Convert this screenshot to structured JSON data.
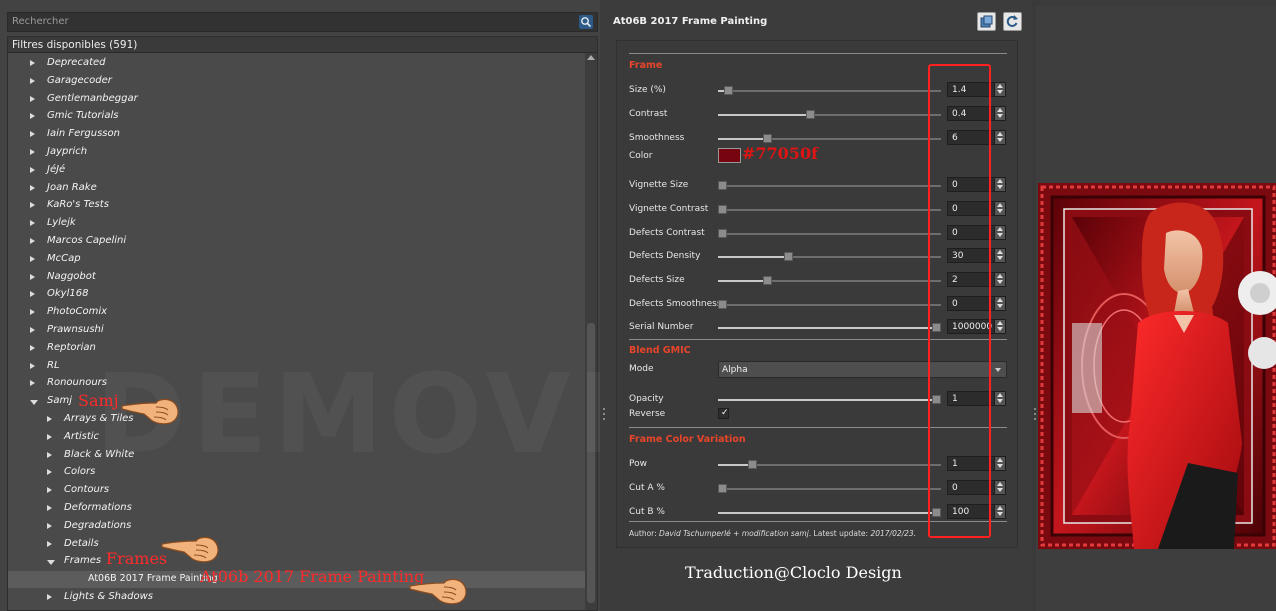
{
  "search": {
    "placeholder": "Rechercher"
  },
  "tree": {
    "header": "Filtres disponibles (591)",
    "items": [
      {
        "label": "Deprecated",
        "level": 0,
        "state": "closed"
      },
      {
        "label": "Garagecoder",
        "level": 0,
        "state": "closed"
      },
      {
        "label": "Gentlemanbeggar",
        "level": 0,
        "state": "closed"
      },
      {
        "label": "Gmic Tutorials",
        "level": 0,
        "state": "closed"
      },
      {
        "label": "Iain Fergusson",
        "level": 0,
        "state": "closed"
      },
      {
        "label": "Jayprich",
        "level": 0,
        "state": "closed"
      },
      {
        "label": "JéJé",
        "level": 0,
        "state": "closed"
      },
      {
        "label": "Joan Rake",
        "level": 0,
        "state": "closed"
      },
      {
        "label": "KaRo's Tests",
        "level": 0,
        "state": "closed"
      },
      {
        "label": "Lylejk",
        "level": 0,
        "state": "closed"
      },
      {
        "label": "Marcos Capelini",
        "level": 0,
        "state": "closed"
      },
      {
        "label": "McCap",
        "level": 0,
        "state": "closed"
      },
      {
        "label": "Naggobot",
        "level": 0,
        "state": "closed"
      },
      {
        "label": "Okyl168",
        "level": 0,
        "state": "closed"
      },
      {
        "label": "PhotoComix",
        "level": 0,
        "state": "closed"
      },
      {
        "label": "Prawnsushi",
        "level": 0,
        "state": "closed"
      },
      {
        "label": "Reptorian",
        "level": 0,
        "state": "closed"
      },
      {
        "label": "RL",
        "level": 0,
        "state": "closed"
      },
      {
        "label": "Ronounours",
        "level": 0,
        "state": "closed"
      },
      {
        "label": "Samj",
        "level": 0,
        "state": "open"
      },
      {
        "label": "Arrays & Tiles",
        "level": 1,
        "state": "closed"
      },
      {
        "label": "Artistic",
        "level": 1,
        "state": "closed"
      },
      {
        "label": "Black & White",
        "level": 1,
        "state": "closed"
      },
      {
        "label": "Colors",
        "level": 1,
        "state": "closed"
      },
      {
        "label": "Contours",
        "level": 1,
        "state": "closed"
      },
      {
        "label": "Deformations",
        "level": 1,
        "state": "closed"
      },
      {
        "label": "Degradations",
        "level": 1,
        "state": "closed"
      },
      {
        "label": "Details",
        "level": 1,
        "state": "closed"
      },
      {
        "label": "Frames",
        "level": 1,
        "state": "open"
      },
      {
        "label": "At06B 2017 Frame Painting",
        "level": 2,
        "state": "leaf"
      },
      {
        "label": "Lights & Shadows",
        "level": 1,
        "state": "closed"
      }
    ]
  },
  "annotations": {
    "samj": "Samj",
    "frames": "Frames",
    "filter": "At06b 2017 Frame Painting",
    "hex": "#77050f",
    "credit": "Traduction@Cloclo Design",
    "watermark": "DEMOVER"
  },
  "filter": {
    "title": "At06B 2017 Frame Painting",
    "sections": {
      "frame": "Frame",
      "blend": "Blend GMIC",
      "variation": "Frame Color Variation"
    },
    "params": [
      {
        "key": "size",
        "label": "Size (%)",
        "value": "1.4",
        "fraction": 0.03
      },
      {
        "key": "contrast",
        "label": "Contrast",
        "value": "0.4",
        "fraction": 0.41
      },
      {
        "key": "smoothness",
        "label": "Smoothness",
        "value": "6",
        "fraction": 0.21
      },
      {
        "key": "vignette_size",
        "label": "Vignette Size",
        "value": "0",
        "fraction": 0.0
      },
      {
        "key": "vignette_contrast",
        "label": "Vignette Contrast",
        "value": "0",
        "fraction": 0.0
      },
      {
        "key": "defects_contrast",
        "label": "Defects Contrast",
        "value": "0",
        "fraction": 0.0
      },
      {
        "key": "defects_density",
        "label": "Defects Density",
        "value": "30",
        "fraction": 0.31
      },
      {
        "key": "defects_size",
        "label": "Defects Size",
        "value": "2",
        "fraction": 0.21
      },
      {
        "key": "defects_smoothness",
        "label": "Defects Smoothness",
        "value": "0",
        "fraction": 0.0
      },
      {
        "key": "serial",
        "label": "Serial Number",
        "value": "1000000",
        "fraction": 1.0
      },
      {
        "key": "opacity",
        "label": "Opacity",
        "value": "1",
        "fraction": 1.0
      },
      {
        "key": "pow",
        "label": "Pow",
        "value": "1",
        "fraction": 0.14
      },
      {
        "key": "cut_a",
        "label": "Cut A %",
        "value": "0",
        "fraction": 0.0
      },
      {
        "key": "cut_b",
        "label": "Cut B %",
        "value": "100",
        "fraction": 1.0
      }
    ],
    "color": {
      "label": "Color",
      "value": "#77050f"
    },
    "mode": {
      "label": "Mode",
      "value": "Alpha"
    },
    "reverse": {
      "label": "Reverse",
      "checked": true
    },
    "author_prefix": "Author:",
    "author_name": "David Tschumperlé + modification samj",
    "latest_prefix": ". Latest update:",
    "latest_date": "2017/02/23."
  },
  "colors": {
    "accent": "#e8452a",
    "annotation": "#ff2020",
    "frame_color": "#77050f"
  }
}
